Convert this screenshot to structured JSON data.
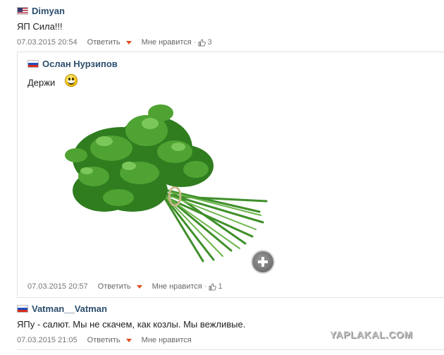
{
  "comments": [
    {
      "author": "Dimyan",
      "flag": "us-flag",
      "text": "ЯП Сила!!!",
      "date": "07.03.2015 20:54",
      "reply_label": "Ответить",
      "like_label": "Мне нравится",
      "likes": "3"
    },
    {
      "author": "Ослан Нурзипов",
      "flag": "ru-flag",
      "text": "Держи",
      "emoticon": "smiley-icon",
      "image": "parsley-bunch-image",
      "date": "07.03.2015 20:57",
      "reply_label": "Ответить",
      "like_label": "Мне нравится",
      "likes": "1"
    },
    {
      "author": "Vatman__Vatman",
      "flag": "ru-flag",
      "text": "ЯПу - салют. Мы не скачем, как козлы. Мы вежливые.",
      "date": "07.03.2015 21:05",
      "reply_label": "Ответить",
      "like_label": "Мне нравится"
    }
  ],
  "watermark": "YAPLAKAL.COM",
  "colors": {
    "author": "#2b4e6e",
    "caret": "#e05020",
    "meta": "#777777"
  }
}
